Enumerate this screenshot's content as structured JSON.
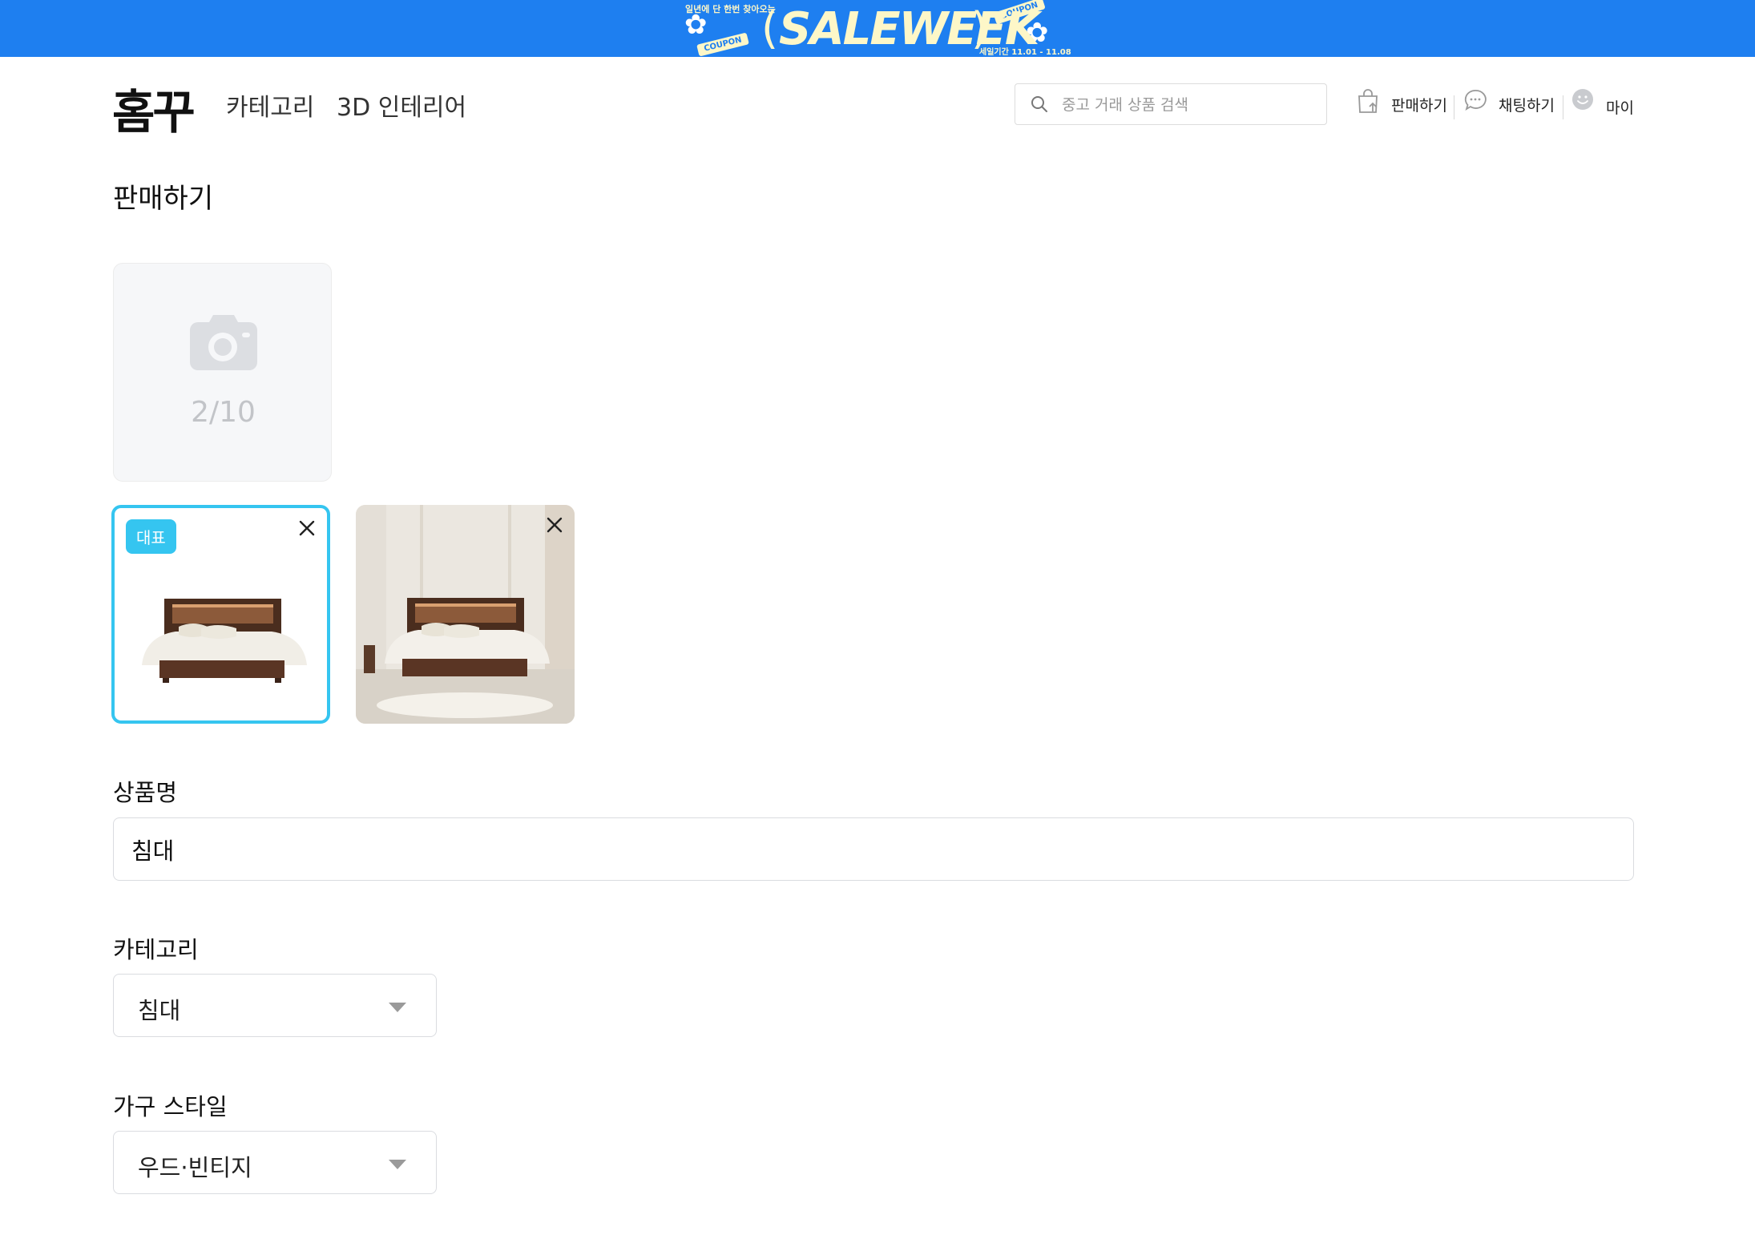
{
  "banner": {
    "title": "SALEWEEK",
    "coupon_label": "COUPON",
    "top_text": "일년에 단 한번 찾아오는",
    "period_text": "세일기간 11.01 - 11.08",
    "background_color": "#1e7ff0"
  },
  "header": {
    "logo": "홈꾸",
    "nav": [
      "카테고리",
      "3D 인테리어"
    ],
    "search_placeholder": "중고 거래 상품 검색",
    "actions": {
      "sell": "판매하기",
      "chat": "채팅하기",
      "my": "마이"
    }
  },
  "page": {
    "title": "판매하기",
    "upload": {
      "count": "2/10"
    },
    "images": {
      "main_badge": "대표"
    },
    "fields": {
      "product_name": {
        "label": "상품명",
        "value": "침대"
      },
      "category": {
        "label": "카테고리",
        "value": "침대"
      },
      "style": {
        "label": "가구 스타일",
        "value": "우드·빈티지"
      }
    }
  },
  "colors": {
    "accent": "#35c5f0"
  }
}
